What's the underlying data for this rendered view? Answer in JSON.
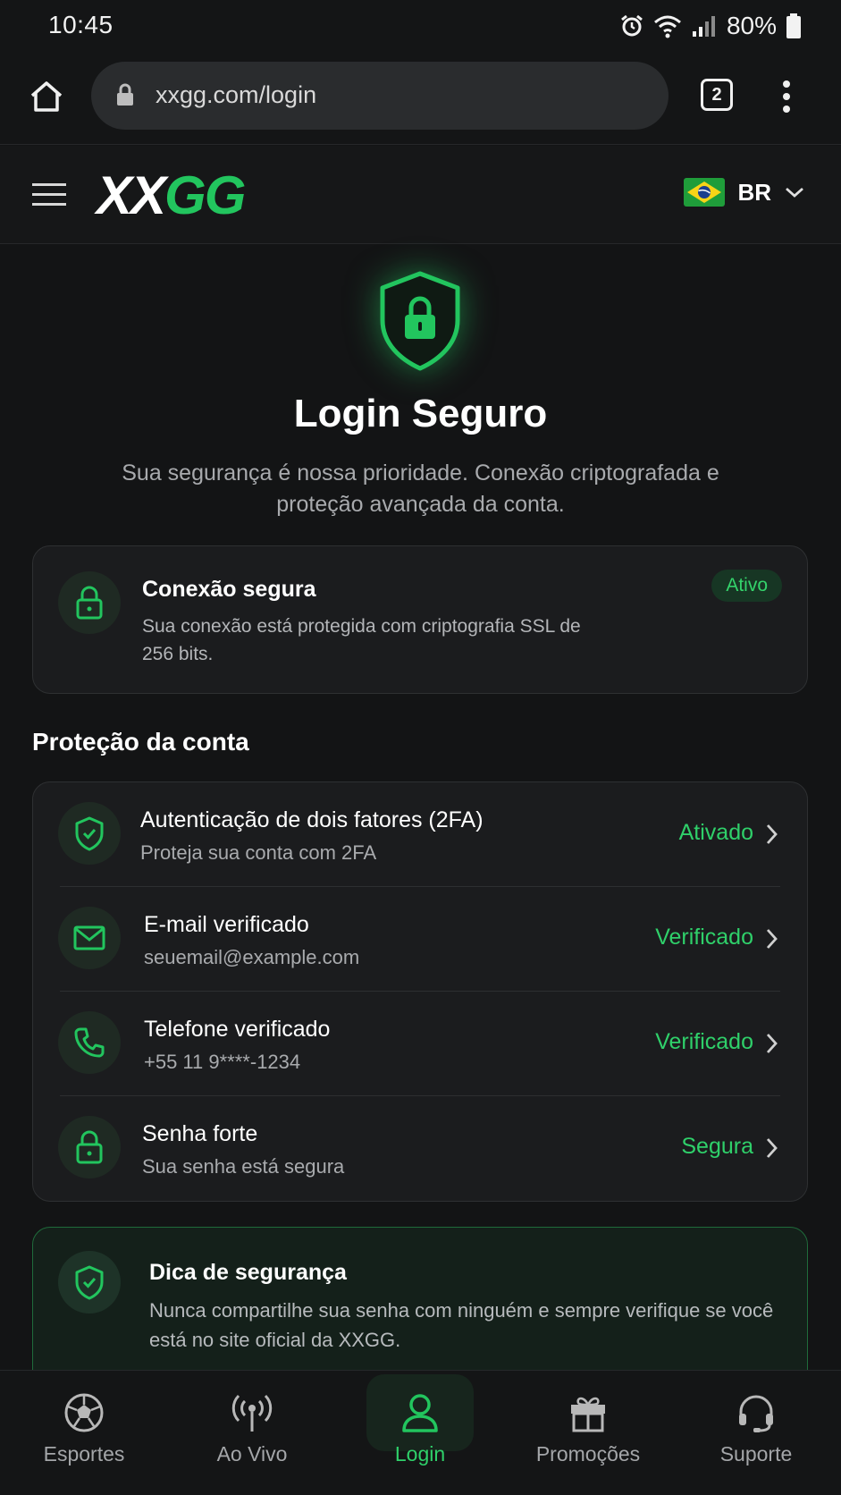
{
  "status_bar": {
    "time": "10:45",
    "battery": "80%",
    "icons": [
      "alarm-icon",
      "wifi-icon",
      "signal-icon",
      "battery-icon"
    ]
  },
  "browser": {
    "url": "xxgg.com/login",
    "tab_count": "2"
  },
  "header": {
    "logo_part1": "XX",
    "logo_part2": "GG",
    "language_code": "BR"
  },
  "hero": {
    "title": "Login Seguro",
    "subtitle": "Sua segurança é nossa prioridade. Conexão criptografada e proteção avançada da conta."
  },
  "connection": {
    "title": "Conexão segura",
    "description": "Sua conexão está protegida com criptografia SSL de 256 bits.",
    "badge": "Ativo"
  },
  "protection": {
    "section_title": "Proteção da conta",
    "items": [
      {
        "title": "Autenticação de dois fatores (2FA)",
        "subtitle": "Proteja sua conta com 2FA",
        "status": "Ativado",
        "icon": "shield-check-icon"
      },
      {
        "title": "E-mail verificado",
        "subtitle": "seuemail@example.com",
        "status": "Verificado",
        "icon": "mail-icon"
      },
      {
        "title": "Telefone verificado",
        "subtitle": "+55 11 9****-1234",
        "status": "Verificado",
        "icon": "phone-icon"
      },
      {
        "title": "Senha forte",
        "subtitle": "Sua senha está segura",
        "status": "Segura",
        "icon": "lock-icon"
      }
    ]
  },
  "tip": {
    "title": "Dica de segurança",
    "description": "Nunca compartilhe sua senha com ninguém e sempre verifique se você está no site oficial da XXGG."
  },
  "bottom_nav": {
    "items": [
      {
        "label": "Esportes",
        "icon": "soccer-ball-icon"
      },
      {
        "label": "Ao Vivo",
        "icon": "broadcast-icon"
      },
      {
        "label": "Login",
        "icon": "user-icon",
        "active": true
      },
      {
        "label": "Promoções",
        "icon": "gift-icon"
      },
      {
        "label": "Suporte",
        "icon": "headset-icon"
      }
    ]
  },
  "colors": {
    "accent": "#22c55e",
    "background": "#131415",
    "card": "#1b1c1e"
  }
}
